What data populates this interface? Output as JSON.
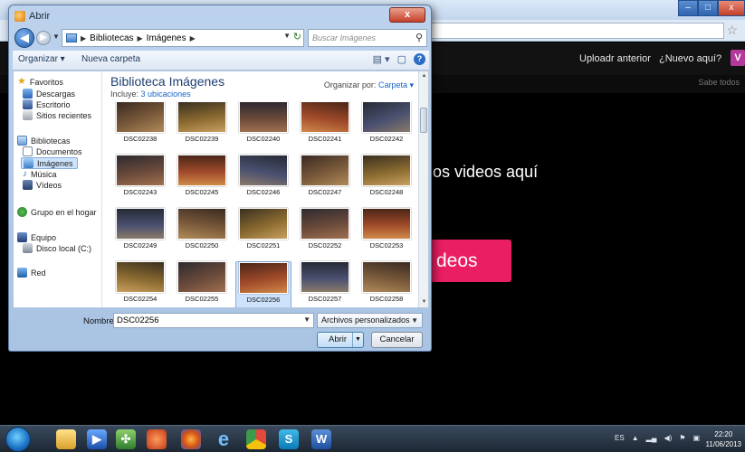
{
  "background": {
    "nav_uploads": "Uploadr anterior",
    "nav_new": "¿Nuevo aquí?",
    "subbar_link": "Sabe todos",
    "heading": "os videos aquí",
    "upload_button": "deos",
    "accent_color": "#e91e63"
  },
  "dialog": {
    "title": "Abrir",
    "close_glyph": "x",
    "breadcrumb": [
      "Bibliotecas",
      "Imágenes"
    ],
    "search_placeholder": "Buscar Imágenes",
    "toolbar": {
      "organize": "Organizar ▾",
      "new_folder": "Nueva carpeta"
    },
    "nav_pane": {
      "favorites": "Favoritos",
      "downloads": "Descargas",
      "desktop": "Escritorio",
      "recent": "Sitios recientes",
      "libraries": "Bibliotecas",
      "documents": "Documentos",
      "images": "Imágenes",
      "music": "Música",
      "videos": "Vídeos",
      "homegroup": "Grupo en el hogar",
      "computer": "Equipo",
      "local_disk": "Disco local (C:)",
      "network": "Red"
    },
    "library": {
      "title": "Biblioteca Imágenes",
      "includes_prefix": "Incluye:",
      "includes_link": "3 ubicaciones",
      "arrange_prefix": "Organizar por:",
      "arrange_value": "Carpeta ▾"
    },
    "files": [
      "DSC02238",
      "DSC02239",
      "DSC02240",
      "DSC02241",
      "DSC02242",
      "DSC02243",
      "DSC02245",
      "DSC02246",
      "DSC02247",
      "DSC02248",
      "DSC02249",
      "DSC02250",
      "DSC02251",
      "DSC02252",
      "DSC02253",
      "DSC02254",
      "DSC02255",
      "DSC02256",
      "DSC02257",
      "DSC02258"
    ],
    "selected_file": "DSC02256",
    "filename_label": "Nombre:",
    "filename_value": "DSC02256",
    "filetype_value": "Archivos personalizados",
    "open_button": "Abrir",
    "cancel_button": "Cancelar"
  },
  "taskbar": {
    "lang": "ES",
    "time": "22:20",
    "date": "11/06/2013"
  }
}
